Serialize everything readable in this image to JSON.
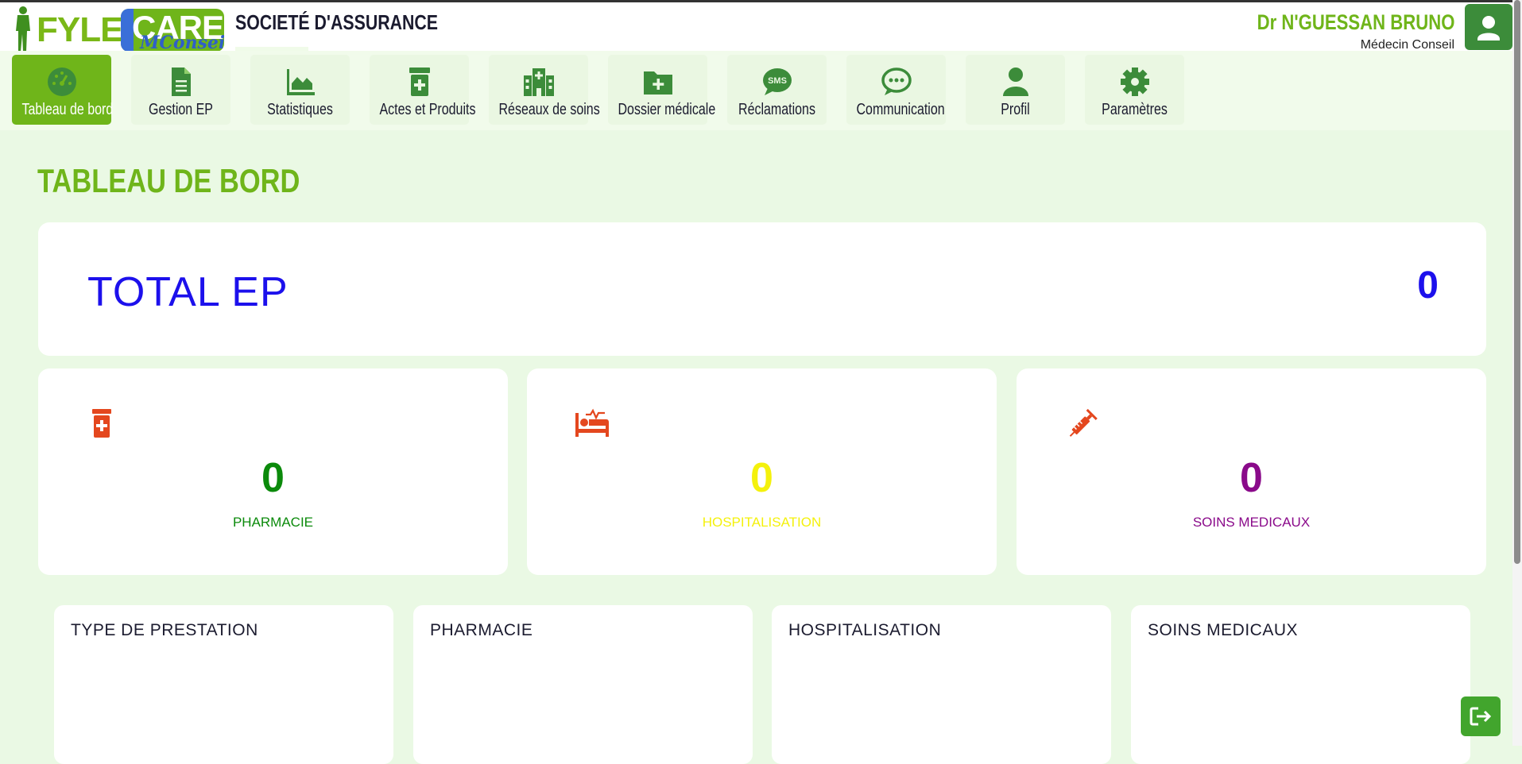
{
  "header": {
    "logo_text": "FYLE CARE MConseil",
    "logo_fyle": "FYLE",
    "logo_care": "CARE",
    "logo_mconseil": "MConseil",
    "company": "SOCIETÉ D'ASSURANCE",
    "user_name": "Dr N'GUESSAN BRUNO",
    "user_role": "Médecin Conseil",
    "avatar_icon": "user-icon"
  },
  "nav": {
    "items": [
      {
        "label": "Tableau de bord",
        "icon": "dashboard-gauge-icon",
        "active": true
      },
      {
        "label": "Gestion EP",
        "icon": "document-icon"
      },
      {
        "label": "Statistiques",
        "icon": "area-chart-icon"
      },
      {
        "label": "Actes et Produits",
        "icon": "pill-bottle-icon"
      },
      {
        "label": "Réseaux de soins",
        "icon": "hospital-icon"
      },
      {
        "label": "Dossier médicale",
        "icon": "folder-plus-icon"
      },
      {
        "label": "Réclamations",
        "icon": "sms-icon"
      },
      {
        "label": "Communication",
        "icon": "chat-bubble-icon"
      },
      {
        "label": "Profil",
        "icon": "user-icon"
      },
      {
        "label": "Paramètres",
        "icon": "gear-icon"
      }
    ]
  },
  "main": {
    "title": "TABLEAU DE BORD",
    "total": {
      "label": "TOTAL EP",
      "value": "0"
    },
    "stats": [
      {
        "label": "PHARMACIE",
        "value": "0",
        "color": "#0b8a0b",
        "icon": "pill-bottle-icon"
      },
      {
        "label": "HOSPITALISATION",
        "value": "0",
        "color": "#f4f10c",
        "icon": "hospital-bed-icon"
      },
      {
        "label": "SOINS MEDICAUX",
        "value": "0",
        "color": "#8a0a8a",
        "icon": "syringe-icon"
      }
    ],
    "panels": [
      {
        "title": "TYPE DE PRESTATION"
      },
      {
        "title": "PHARMACIE"
      },
      {
        "title": "HOSPITALISATION"
      },
      {
        "title": "SOINS MEDICAUX"
      }
    ]
  },
  "actions": {
    "logout_icon": "logout-icon"
  },
  "colors": {
    "brand_green": "#6fb51a",
    "dark_green": "#3c8c3a",
    "total_blue": "#1c10ec",
    "icon_red": "#e4471e"
  }
}
